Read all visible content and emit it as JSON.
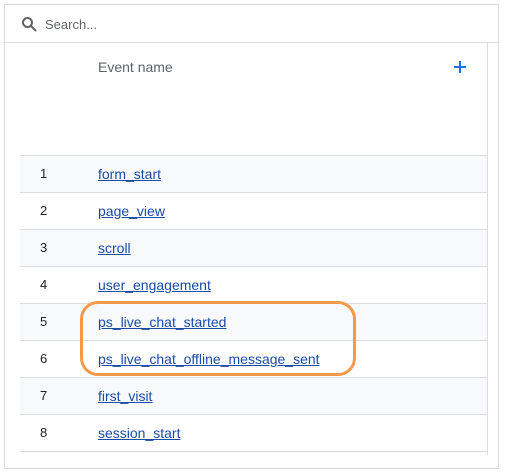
{
  "search": {
    "placeholder": "Search..."
  },
  "table": {
    "column_header": "Event name",
    "rows": [
      {
        "index": "1",
        "name": "form_start"
      },
      {
        "index": "2",
        "name": "page_view"
      },
      {
        "index": "3",
        "name": "scroll"
      },
      {
        "index": "4",
        "name": "user_engagement"
      },
      {
        "index": "5",
        "name": "ps_live_chat_started"
      },
      {
        "index": "6",
        "name": "ps_live_chat_offline_message_sent"
      },
      {
        "index": "7",
        "name": "first_visit"
      },
      {
        "index": "8",
        "name": "session_start"
      }
    ]
  },
  "colors": {
    "link": "#1a4ca6",
    "accent": "#1a73e8",
    "highlight": "#f2994a",
    "border": "#dadce0"
  },
  "icons": {
    "search": "search-icon",
    "add": "add-icon"
  }
}
